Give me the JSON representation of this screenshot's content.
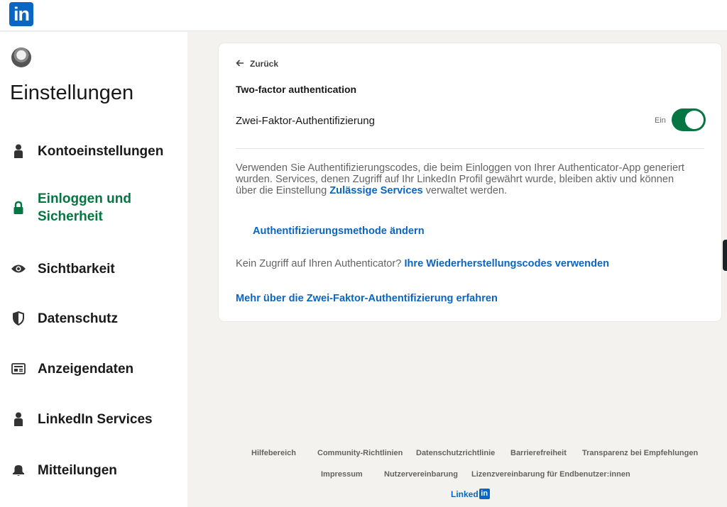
{
  "topbar": {
    "logo_text": "in"
  },
  "sidebar": {
    "title": "Einstellungen",
    "items": [
      {
        "label": "Kontoeinstellungen",
        "icon": "person-icon",
        "active": false
      },
      {
        "label": "Einloggen und Sicherheit",
        "line1": "Einloggen und",
        "line2": "Sicherheit",
        "icon": "lock-icon",
        "active": true
      },
      {
        "label": "Sichtbarkeit",
        "icon": "eye-icon",
        "active": false
      },
      {
        "label": "Datenschutz",
        "icon": "shield-icon",
        "active": false
      },
      {
        "label": "Anzeigendaten",
        "icon": "ad-icon",
        "active": false
      },
      {
        "label": "LinkedIn Services",
        "icon": "person-icon",
        "active": false
      },
      {
        "label": "Mitteilungen",
        "icon": "bell-icon",
        "active": false
      }
    ]
  },
  "main": {
    "back_label": "Zurück",
    "title": "Two-factor authentication",
    "toggle_label": "Zwei-Faktor-Authentifizierung",
    "toggle_state": "Ein",
    "toggle_on": true,
    "description_part1": "Verwenden Sie Authentifizierungscodes, die beim Einloggen von Ihrer Authenticator-App generiert wurden. Services, denen Zugriff auf Ihr LinkedIn Profil gewährt wurde, bleiben aktiv und können über die Einstellung ",
    "description_link": "Zulässige Services",
    "description_part2": " verwaltet werden.",
    "change_method_link": "Authentifizierungsmethode ändern",
    "no_access_text": "Kein Zugriff auf Ihren Authenticator? ",
    "recovery_link": "Ihre Wiederherstellungscodes verwenden",
    "learn_more_link": "Mehr über die Zwei-Faktor-Authentifizierung erfahren"
  },
  "footer": {
    "row1": [
      "Hilfebereich",
      "Community-Richtlinien",
      "Datenschutzrichtlinie",
      "Barrierefreiheit",
      "Transparenz bei Empfehlungen"
    ],
    "row2": [
      "Impressum",
      "Nutzervereinbarung",
      "Lizenzvereinbarung für Endbenutzer:innen"
    ],
    "brand_text": "Linked",
    "brand_box": "in"
  },
  "colors": {
    "brand_blue": "#0a66c2",
    "active_green": "#057642",
    "page_bg": "#f4f2ee"
  }
}
